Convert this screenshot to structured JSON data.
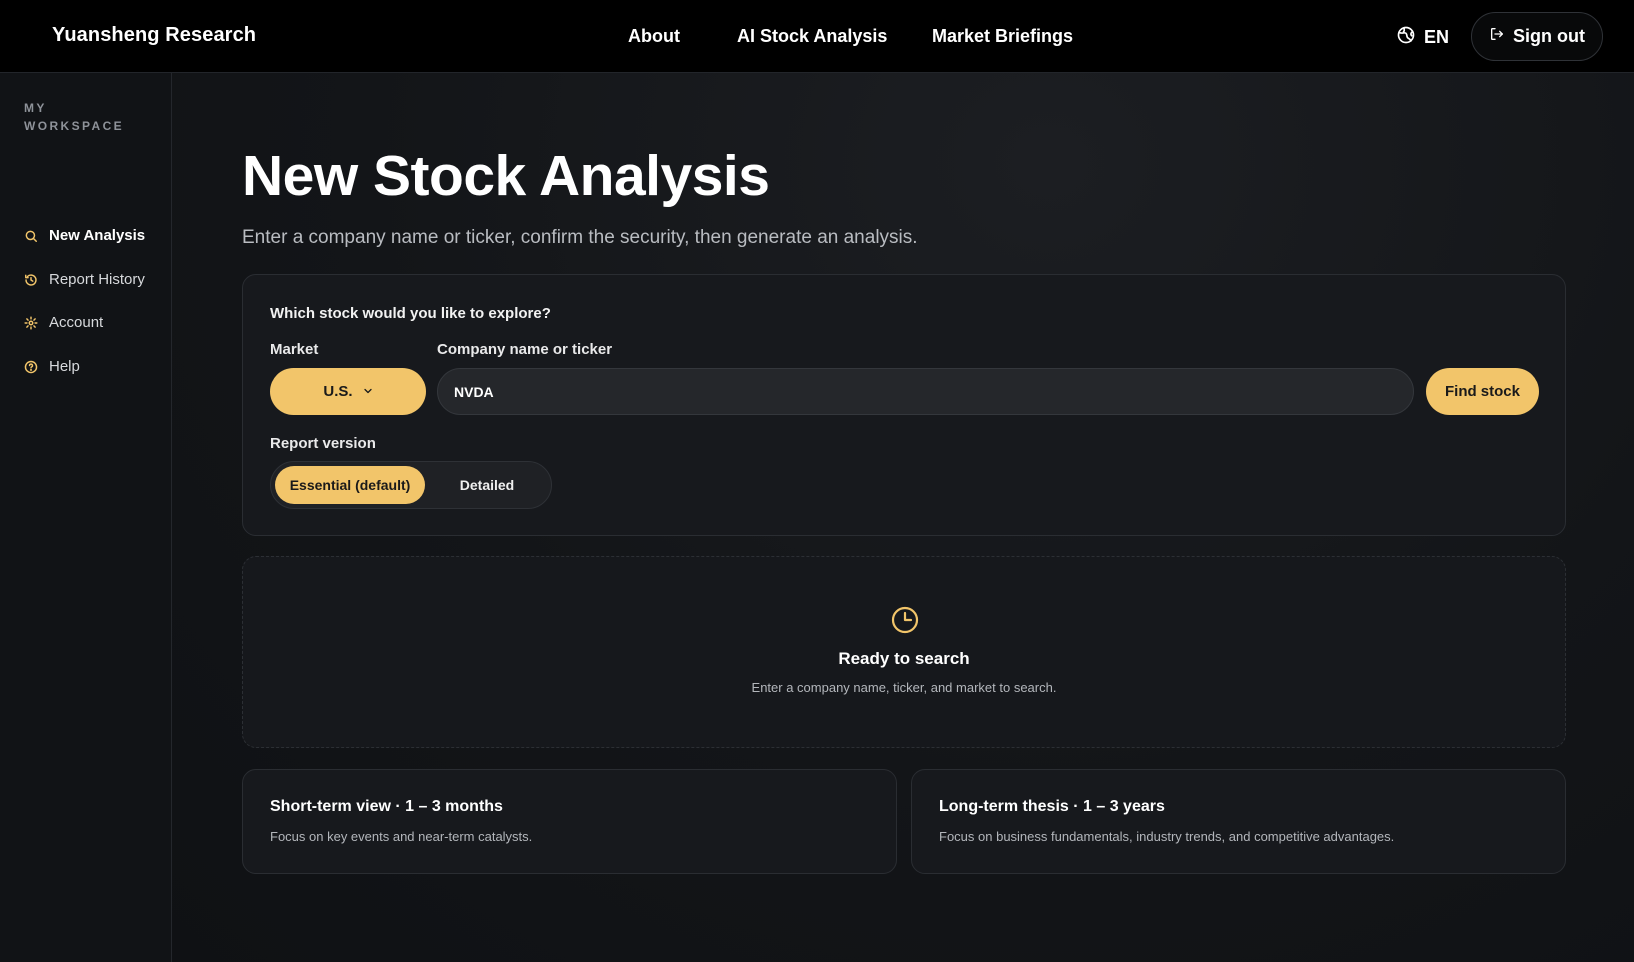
{
  "header": {
    "brand": "Yuansheng Research",
    "nav": {
      "about": "About",
      "ai_stock_analysis": "AI Stock Analysis",
      "market_briefings": "Market Briefings"
    },
    "language": "EN",
    "language_icon": "globe-icon",
    "sign_out": "Sign out",
    "sign_out_icon": "logout-icon"
  },
  "sidebar": {
    "section_label": "MY WORKSPACE",
    "items": [
      {
        "label": "New Analysis",
        "icon": "search-icon",
        "active": true
      },
      {
        "label": "Report History",
        "icon": "history-icon",
        "active": false
      },
      {
        "label": "Account",
        "icon": "gear-icon",
        "active": false
      },
      {
        "label": "Help",
        "icon": "help-icon",
        "active": false
      }
    ]
  },
  "main": {
    "title": "New Stock Analysis",
    "subtitle": "Enter a company name or ticker, confirm the security, then generate an analysis.",
    "search": {
      "question": "Which stock would you like to explore?",
      "market_label": "Market",
      "market_value": "U.S.",
      "company_label": "Company name or ticker",
      "company_value": "NVDA",
      "find_button": "Find stock",
      "version_label": "Report version",
      "version_options": [
        "Essential (default)",
        "Detailed"
      ],
      "version_selected": "Essential (default)"
    },
    "ready": {
      "icon": "clock-icon",
      "title": "Ready to search",
      "description": "Enter a company name, ticker, and market to search."
    },
    "views": [
      {
        "title": "Short-term view · 1 – 3 months",
        "description": "Focus on key events and near-term catalysts."
      },
      {
        "title": "Long-term thesis · 1 – 3 years",
        "description": "Focus on business fundamentals, industry trends, and competitive advantages."
      }
    ]
  },
  "colors": {
    "accent": "#f2c56a",
    "background": "#0f1114",
    "topbar": "#000000",
    "card": "#17191d"
  }
}
